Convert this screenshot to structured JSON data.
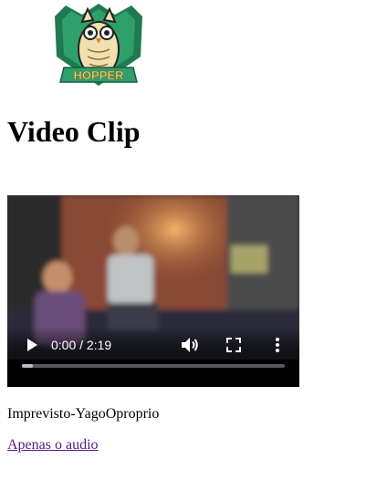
{
  "logo": {
    "text": "HOPPER",
    "icon": "owl-logo-icon"
  },
  "page": {
    "title": "Video Clip"
  },
  "video": {
    "time_display": "0:00 / 2:19",
    "progress_fraction": 0.04,
    "icons": {
      "play": "play-icon",
      "volume": "volume-icon",
      "fullscreen": "fullscreen-icon",
      "more": "more-options-icon"
    }
  },
  "file": {
    "name": "Imprevisto-YagoOproprio"
  },
  "links": {
    "audio_only": "Apenas o audio"
  },
  "colors": {
    "logo_green": "#1f7a52",
    "logo_gold": "#e7c766",
    "link_visited": "#551a8b"
  }
}
